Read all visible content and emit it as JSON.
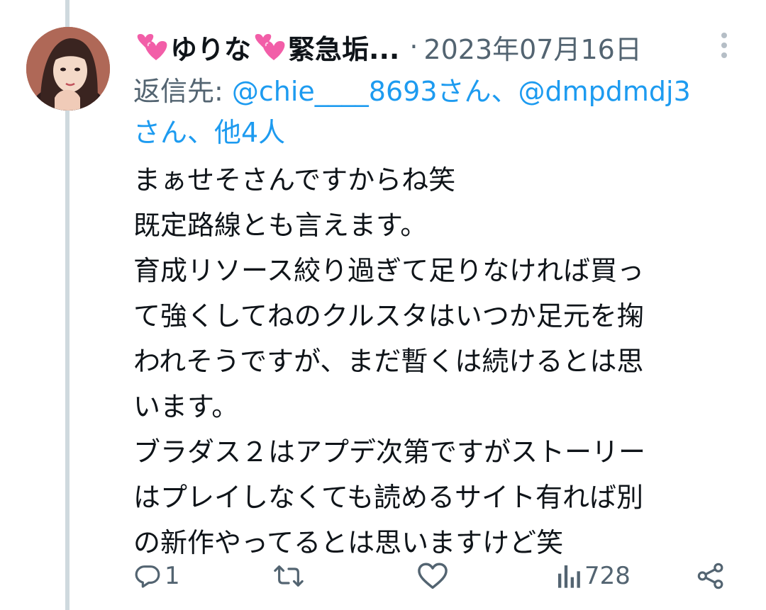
{
  "tweet": {
    "author": {
      "name_before_heart": "",
      "name_middle": "ゆりな",
      "name_after": "緊急垢...",
      "name_full": "💞ゆりな💞緊急垢..."
    },
    "date_separator": "·",
    "date": "2023年07月16日",
    "reply_to": {
      "prefix": "返信先: ",
      "mention1": "@chie____8693さん、@dmpdmdj3",
      "line2": "さん、他4人"
    },
    "text_lines": [
      "まぁせそさんですからね笑",
      "既定路線とも言えます。",
      "育成リソース絞り過ぎて足りなければ買っ",
      "て強くしてねのクルスタはいつか足元を掬",
      "われそうですが、まだ暫くは続けるとは思",
      "います。",
      "ブラダス２はアプデ次第ですがストーリー",
      "はプレイしなくても読めるサイト有れば別",
      "の新作やってるとは思いますけど笑"
    ],
    "actions": {
      "reply_count": "1",
      "retweet_count": "",
      "like_count": "",
      "view_count": "728"
    }
  },
  "colors": {
    "text": "#0f1419",
    "secondary": "#536471",
    "link": "#1d9bf0",
    "heart": "#f25ea8"
  }
}
